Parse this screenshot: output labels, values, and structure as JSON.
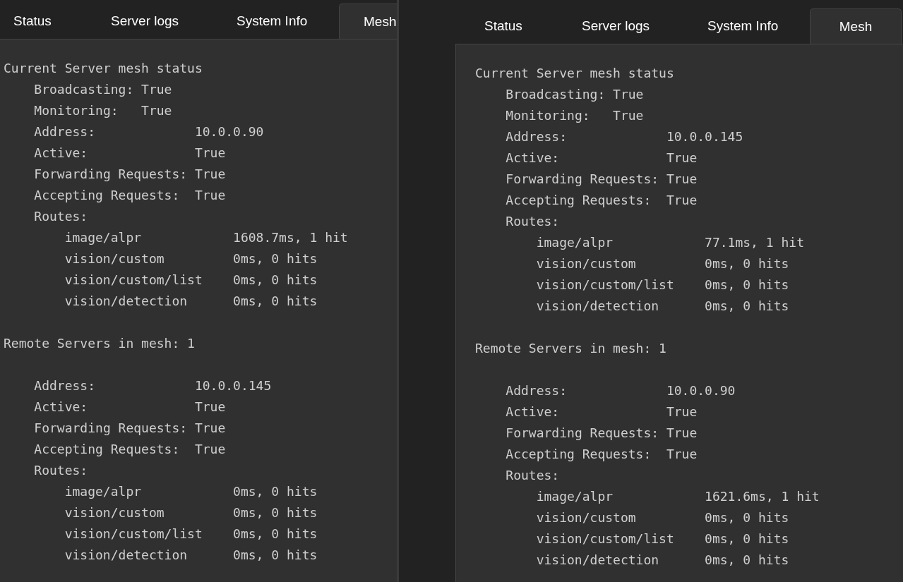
{
  "panels": [
    {
      "tabs": [
        {
          "label": "Status",
          "selected": false
        },
        {
          "label": "Server logs",
          "selected": false
        },
        {
          "label": "System Info",
          "selected": false
        },
        {
          "label": "Mesh",
          "selected": true
        }
      ],
      "current": {
        "title": "Current Server mesh status",
        "flags": [
          {
            "label": "Broadcasting:",
            "value": "True"
          },
          {
            "label": "Monitoring:",
            "value": "True"
          }
        ],
        "server": {
          "fields": [
            {
              "label": "Address:",
              "value": "10.0.0.90"
            },
            {
              "label": "Active:",
              "value": "True"
            },
            {
              "label": "Forwarding Requests:",
              "value": "True"
            },
            {
              "label": "Accepting Requests:",
              "value": "True"
            }
          ],
          "routes_label": "Routes:",
          "routes": [
            {
              "route": "image/alpr",
              "stats": "1608.7ms, 1 hit"
            },
            {
              "route": "vision/custom",
              "stats": "0ms, 0 hits"
            },
            {
              "route": "vision/custom/list",
              "stats": "0ms, 0 hits"
            },
            {
              "route": "vision/detection",
              "stats": "0ms, 0 hits"
            }
          ]
        }
      },
      "remote": {
        "title": "Remote Servers in mesh: 1",
        "servers": [
          {
            "fields": [
              {
                "label": "Address:",
                "value": "10.0.0.145"
              },
              {
                "label": "Active:",
                "value": "True"
              },
              {
                "label": "Forwarding Requests:",
                "value": "True"
              },
              {
                "label": "Accepting Requests:",
                "value": "True"
              }
            ],
            "routes_label": "Routes:",
            "routes": [
              {
                "route": "image/alpr",
                "stats": "0ms, 0 hits"
              },
              {
                "route": "vision/custom",
                "stats": "0ms, 0 hits"
              },
              {
                "route": "vision/custom/list",
                "stats": "0ms, 0 hits"
              },
              {
                "route": "vision/detection",
                "stats": "0ms, 0 hits"
              }
            ]
          }
        ]
      }
    },
    {
      "tabs": [
        {
          "label": "Status",
          "selected": false
        },
        {
          "label": "Server logs",
          "selected": false
        },
        {
          "label": "System Info",
          "selected": false
        },
        {
          "label": "Mesh",
          "selected": true
        }
      ],
      "current": {
        "title": "Current Server mesh status",
        "flags": [
          {
            "label": "Broadcasting:",
            "value": "True"
          },
          {
            "label": "Monitoring:",
            "value": "True"
          }
        ],
        "server": {
          "fields": [
            {
              "label": "Address:",
              "value": "10.0.0.145"
            },
            {
              "label": "Active:",
              "value": "True"
            },
            {
              "label": "Forwarding Requests:",
              "value": "True"
            },
            {
              "label": "Accepting Requests:",
              "value": "True"
            }
          ],
          "routes_label": "Routes:",
          "routes": [
            {
              "route": "image/alpr",
              "stats": "77.1ms, 1 hit"
            },
            {
              "route": "vision/custom",
              "stats": "0ms, 0 hits"
            },
            {
              "route": "vision/custom/list",
              "stats": "0ms, 0 hits"
            },
            {
              "route": "vision/detection",
              "stats": "0ms, 0 hits"
            }
          ]
        }
      },
      "remote": {
        "title": "Remote Servers in mesh: 1",
        "servers": [
          {
            "fields": [
              {
                "label": "Address:",
                "value": "10.0.0.90"
              },
              {
                "label": "Active:",
                "value": "True"
              },
              {
                "label": "Forwarding Requests:",
                "value": "True"
              },
              {
                "label": "Accepting Requests:",
                "value": "True"
              }
            ],
            "routes_label": "Routes:",
            "routes": [
              {
                "route": "image/alpr",
                "stats": "1621.6ms, 1 hit"
              },
              {
                "route": "vision/custom",
                "stats": "0ms, 0 hits"
              },
              {
                "route": "vision/custom/list",
                "stats": "0ms, 0 hits"
              },
              {
                "route": "vision/detection",
                "stats": "0ms, 0 hits"
              }
            ]
          }
        ]
      }
    }
  ]
}
